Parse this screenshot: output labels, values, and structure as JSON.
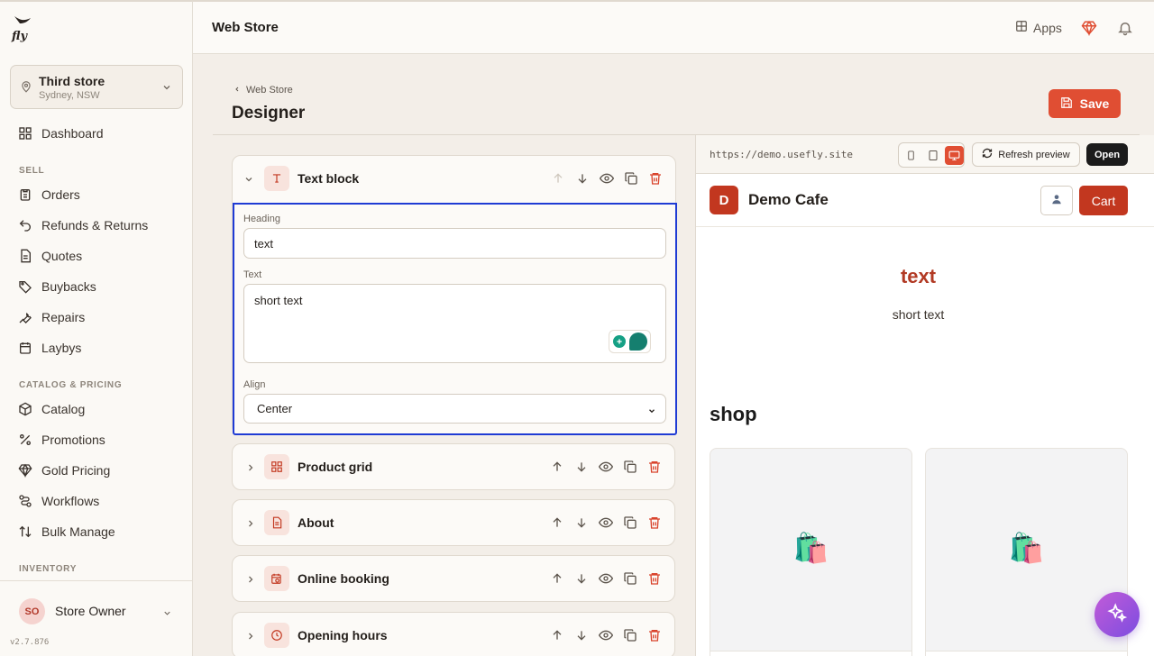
{
  "app": {
    "logo_text": "fly",
    "version": "v2.7.876"
  },
  "store_switcher": {
    "name": "Third store",
    "location": "Sydney, NSW"
  },
  "sidebar": {
    "dashboard": "Dashboard",
    "sections": {
      "sell": "SELL",
      "catalog": "CATALOG & PRICING",
      "inventory": "INVENTORY"
    },
    "sell_items": [
      "Orders",
      "Refunds & Returns",
      "Quotes",
      "Buybacks",
      "Repairs",
      "Laybys"
    ],
    "catalog_items": [
      "Catalog",
      "Promotions",
      "Gold Pricing",
      "Workflows",
      "Bulk Manage"
    ],
    "user": {
      "initials": "SO",
      "name": "Store Owner"
    }
  },
  "topbar": {
    "title": "Web Store",
    "apps_label": "Apps"
  },
  "page": {
    "breadcrumb": "Web Store",
    "title": "Designer",
    "save_label": "Save"
  },
  "blocks": {
    "open": {
      "title": "Text block",
      "heading_label": "Heading",
      "heading_value": "text",
      "text_label": "Text",
      "text_value": "short text",
      "align_label": "Align",
      "align_value": "Center"
    },
    "collapsed": [
      "Product grid",
      "About",
      "Online booking",
      "Opening hours"
    ]
  },
  "preview": {
    "url": "https://demo.usefly.site",
    "refresh_label": "Refresh preview",
    "open_label": "Open",
    "site": {
      "logo_letter": "D",
      "name": "Demo Cafe",
      "cart_label": "Cart",
      "heading": "text",
      "text": "short text",
      "shop_heading": "shop",
      "product_icon": "🛍️"
    }
  },
  "colors": {
    "accent": "#e04e33",
    "site_brand": "#c2371f",
    "selection_outline": "#1f3bd4"
  }
}
